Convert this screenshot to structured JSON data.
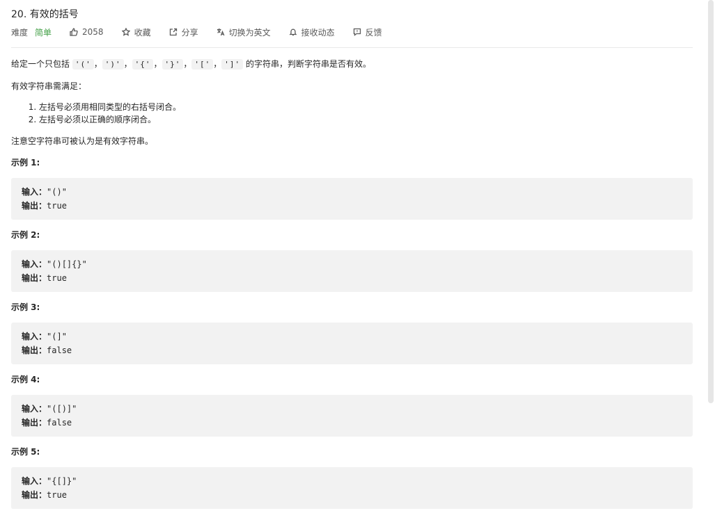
{
  "problem": {
    "title": "20. 有效的括号",
    "difficulty_label": "难度",
    "difficulty_value": "简单",
    "likes": "2058",
    "favorite_label": "收藏",
    "share_label": "分享",
    "switch_lang_label": "切换为英文",
    "subscribe_label": "接收动态",
    "feedback_label": "反馈"
  },
  "description": {
    "intro_prefix": "给定一个只包括 ",
    "chars": [
      "'('",
      "')'",
      "'{'",
      "'}'",
      "'['",
      "']'"
    ],
    "sep": "，",
    "intro_suffix": " 的字符串，判断字符串是否有效。",
    "conditions_intro": "有效字符串需满足：",
    "conditions": [
      "左括号必须用相同类型的右括号闭合。",
      "左括号必须以正确的顺序闭合。"
    ],
    "note": "注意空字符串可被认为是有效字符串。"
  },
  "examples": [
    {
      "title": "示例 1:",
      "input_label": "输入：",
      "input": "\"()\"",
      "output_label": "输出：",
      "output": "true"
    },
    {
      "title": "示例 2:",
      "input_label": "输入：",
      "input": "\"()[]{}\"",
      "output_label": "输出：",
      "output": "true"
    },
    {
      "title": "示例 3:",
      "input_label": "输入：",
      "input": "\"(]\"",
      "output_label": "输出：",
      "output": "false"
    },
    {
      "title": "示例 4:",
      "input_label": "输入：",
      "input": "\"([)]\"",
      "output_label": "输出：",
      "output": "false"
    },
    {
      "title": "示例 5:",
      "input_label": "输入：",
      "input": "\"{[]}\"",
      "output_label": "输出：",
      "output": "true"
    }
  ],
  "colors": {
    "difficulty_easy": "#43a047",
    "code_bg": "#f2f2f2"
  }
}
